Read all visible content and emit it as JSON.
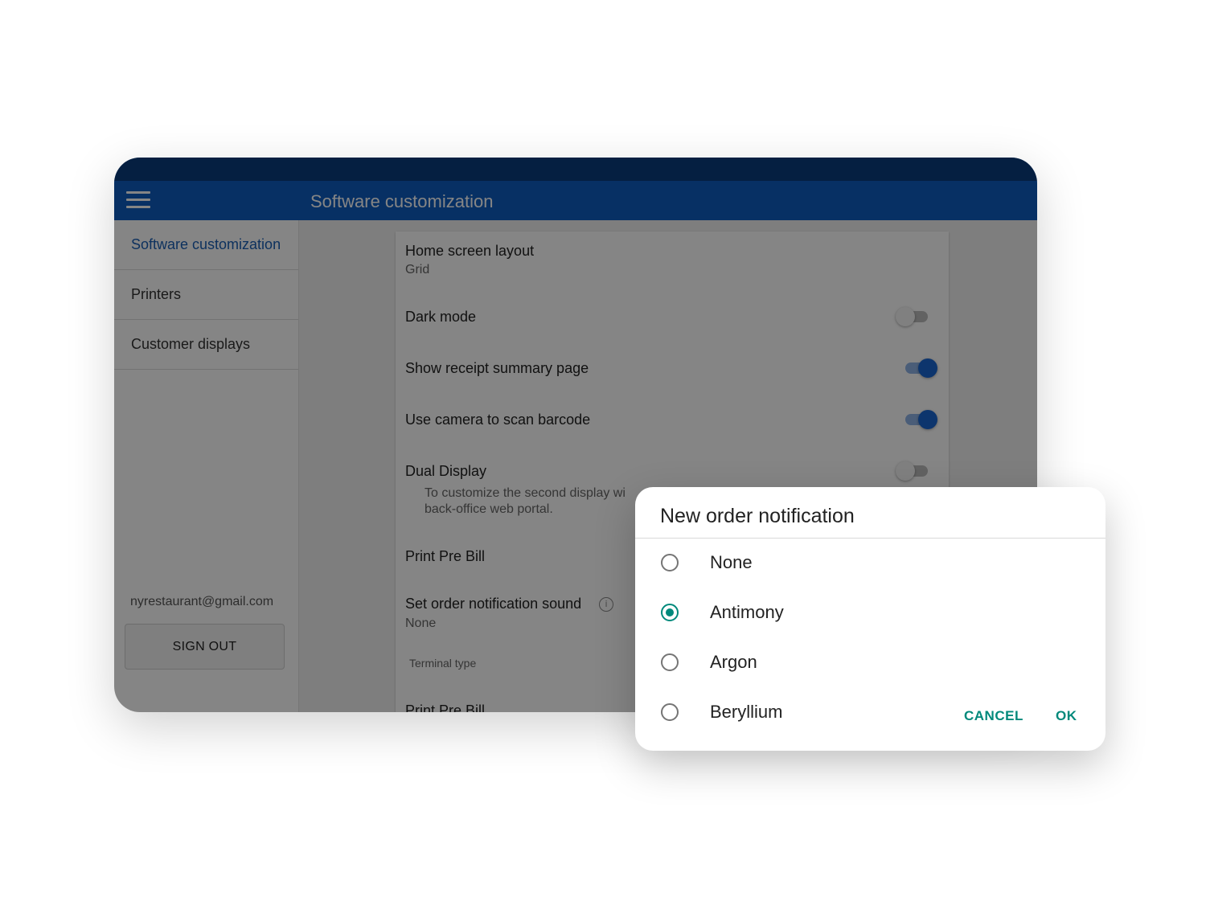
{
  "app": {
    "title": "Software customization"
  },
  "sidebar": {
    "items": [
      {
        "label": "Software customization"
      },
      {
        "label": "Printers"
      },
      {
        "label": "Customer displays"
      }
    ],
    "email": "nyrestaurant@gmail.com",
    "sign_out_label": "SIGN OUT"
  },
  "settings": {
    "home_layout": {
      "title": "Home screen layout",
      "value": "Grid"
    },
    "dark_mode": {
      "title": "Dark mode",
      "enabled": false
    },
    "receipt_summary": {
      "title": "Show receipt summary page",
      "enabled": true
    },
    "camera_scan": {
      "title": "Use camera to scan barcode",
      "enabled": true
    },
    "dual_display": {
      "title": "Dual Display",
      "enabled": false,
      "desc_line1": "To customize the second display wi",
      "desc_line2": "back-office web portal."
    },
    "print_pre_bill": {
      "title": "Print Pre Bill"
    },
    "notification_sound": {
      "title": "Set order notification sound",
      "value": "None"
    },
    "terminal_type": {
      "label": "Terminal type"
    },
    "print_pre_bill_2": {
      "title": "Print Pre Bill"
    }
  },
  "dialog": {
    "title": "New order notification",
    "options": [
      {
        "label": "None",
        "selected": false
      },
      {
        "label": "Antimony",
        "selected": true
      },
      {
        "label": "Argon",
        "selected": false
      },
      {
        "label": "Beryllium",
        "selected": false
      }
    ],
    "cancel_label": "CANCEL",
    "ok_label": "OK"
  },
  "colors": {
    "appbar": "#0f5cc0",
    "statusbar": "#0b3c7d",
    "accent": "#00897b",
    "toggle_on": "#1a66d2"
  },
  "icons": [
    "menu-icon",
    "info-icon"
  ]
}
